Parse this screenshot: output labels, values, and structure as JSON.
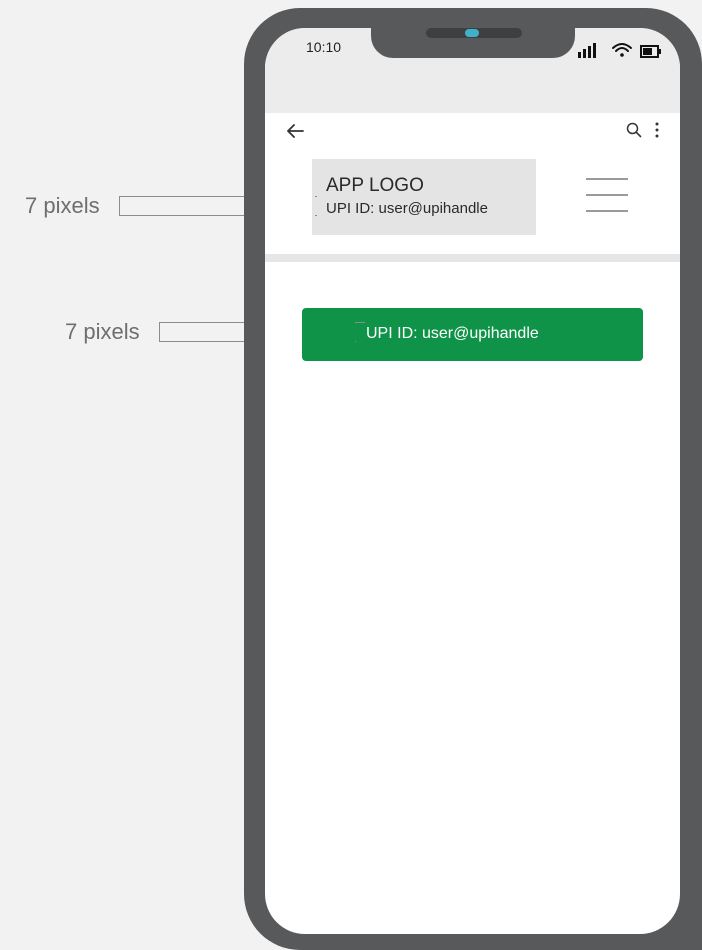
{
  "annotations": {
    "logo_spacing_label": "7 pixels",
    "button_spacing_label": "7 pixels"
  },
  "status_bar": {
    "time": "10:10",
    "icons": [
      "signal-icon",
      "wifi-icon",
      "battery-icon"
    ]
  },
  "top_bar": {
    "back_icon": "back-arrow-icon",
    "search_icon": "search-icon",
    "more_icon": "more-vertical-icon"
  },
  "header": {
    "logo_text": "APP LOGO",
    "upi_id": "UPI ID: user@upihandle",
    "menu_icon": "hamburger-menu-icon"
  },
  "main": {
    "upi_button_label": "UPI ID: user@upihandle"
  },
  "colors": {
    "button_green": "#0f9349",
    "phone_frame": "#58595b",
    "camera_accent": "#3fb2c9",
    "page_background": "#f1f2f1"
  }
}
